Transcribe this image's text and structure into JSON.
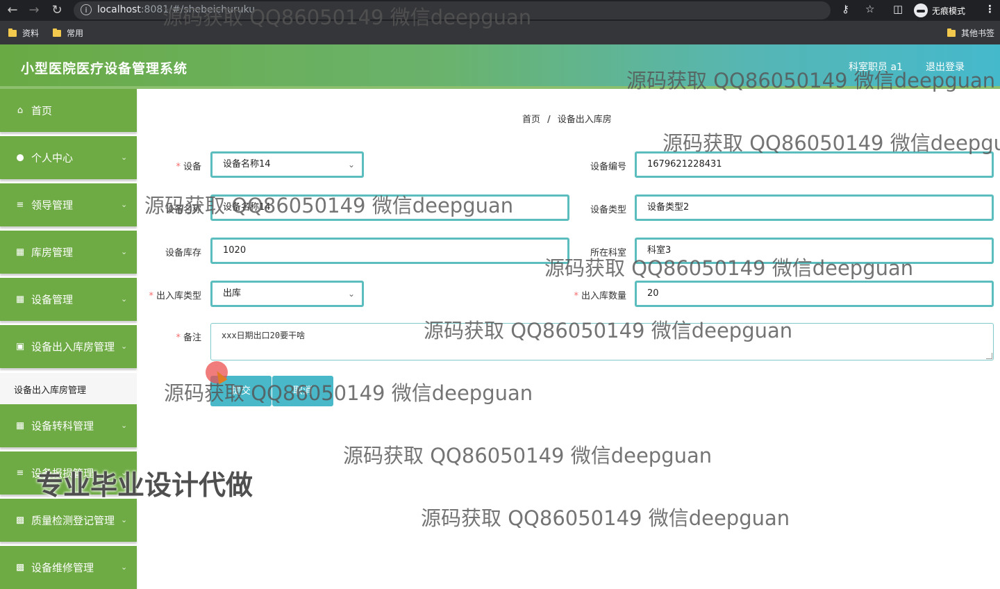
{
  "browser": {
    "url_host": "localhost",
    "url_rest": ":8081/#/shebeichuruku",
    "incognito_label": "无痕模式",
    "bookmarks": [
      "资料",
      "常用"
    ],
    "other_bookmarks": "其他书签"
  },
  "header": {
    "title": "小型医院医疗设备管理系统",
    "user": "科室职员 a1",
    "logout": "退出登录"
  },
  "sidebar": {
    "items": [
      {
        "label": "首页",
        "icon": "home-icon"
      },
      {
        "label": "个人中心",
        "icon": "user-icon"
      },
      {
        "label": "领导管理",
        "icon": "menu-icon"
      },
      {
        "label": "库房管理",
        "icon": "grid-icon"
      },
      {
        "label": "设备管理",
        "icon": "grid-icon"
      },
      {
        "label": "设备出入库房管理",
        "icon": "briefcase-icon"
      },
      {
        "label": "设备转科管理",
        "icon": "grid-icon"
      },
      {
        "label": "设备报损管理",
        "icon": "sliders-icon"
      },
      {
        "label": "质量检测登记管理",
        "icon": "chart-icon"
      },
      {
        "label": "设备维修管理",
        "icon": "chart-icon"
      }
    ],
    "active_submenu": "设备出入库房管理"
  },
  "breadcrumb": {
    "home": "首页",
    "sep": "/",
    "current": "设备出入库房"
  },
  "form": {
    "device": {
      "label": "设备",
      "value": "设备名称14",
      "required": true
    },
    "device_code": {
      "label": "设备编号",
      "value": "1679621228431"
    },
    "device_name": {
      "label": "设备名称",
      "value": "设备名称14"
    },
    "device_type": {
      "label": "设备类型",
      "value": "设备类型2"
    },
    "device_stock": {
      "label": "设备库存",
      "value": "1020"
    },
    "department": {
      "label": "所在科室",
      "value": "科室3"
    },
    "inout_type": {
      "label": "出入库类型",
      "value": "出库",
      "required": true
    },
    "inout_qty": {
      "label": "出入库数量",
      "value": "20",
      "required": true
    },
    "remark": {
      "label": "备注",
      "value": "xxx日期出口20要干啥",
      "required": true
    },
    "submit": "提交",
    "cancel": "取消"
  },
  "watermark": {
    "text": "源码获取 QQ86050149 微信deepguan",
    "promo": "专业毕业设计代做"
  },
  "colors": {
    "sidebar_green": "#6eab44",
    "field_border": "#5bbdbd",
    "button": "#49b9c9"
  }
}
